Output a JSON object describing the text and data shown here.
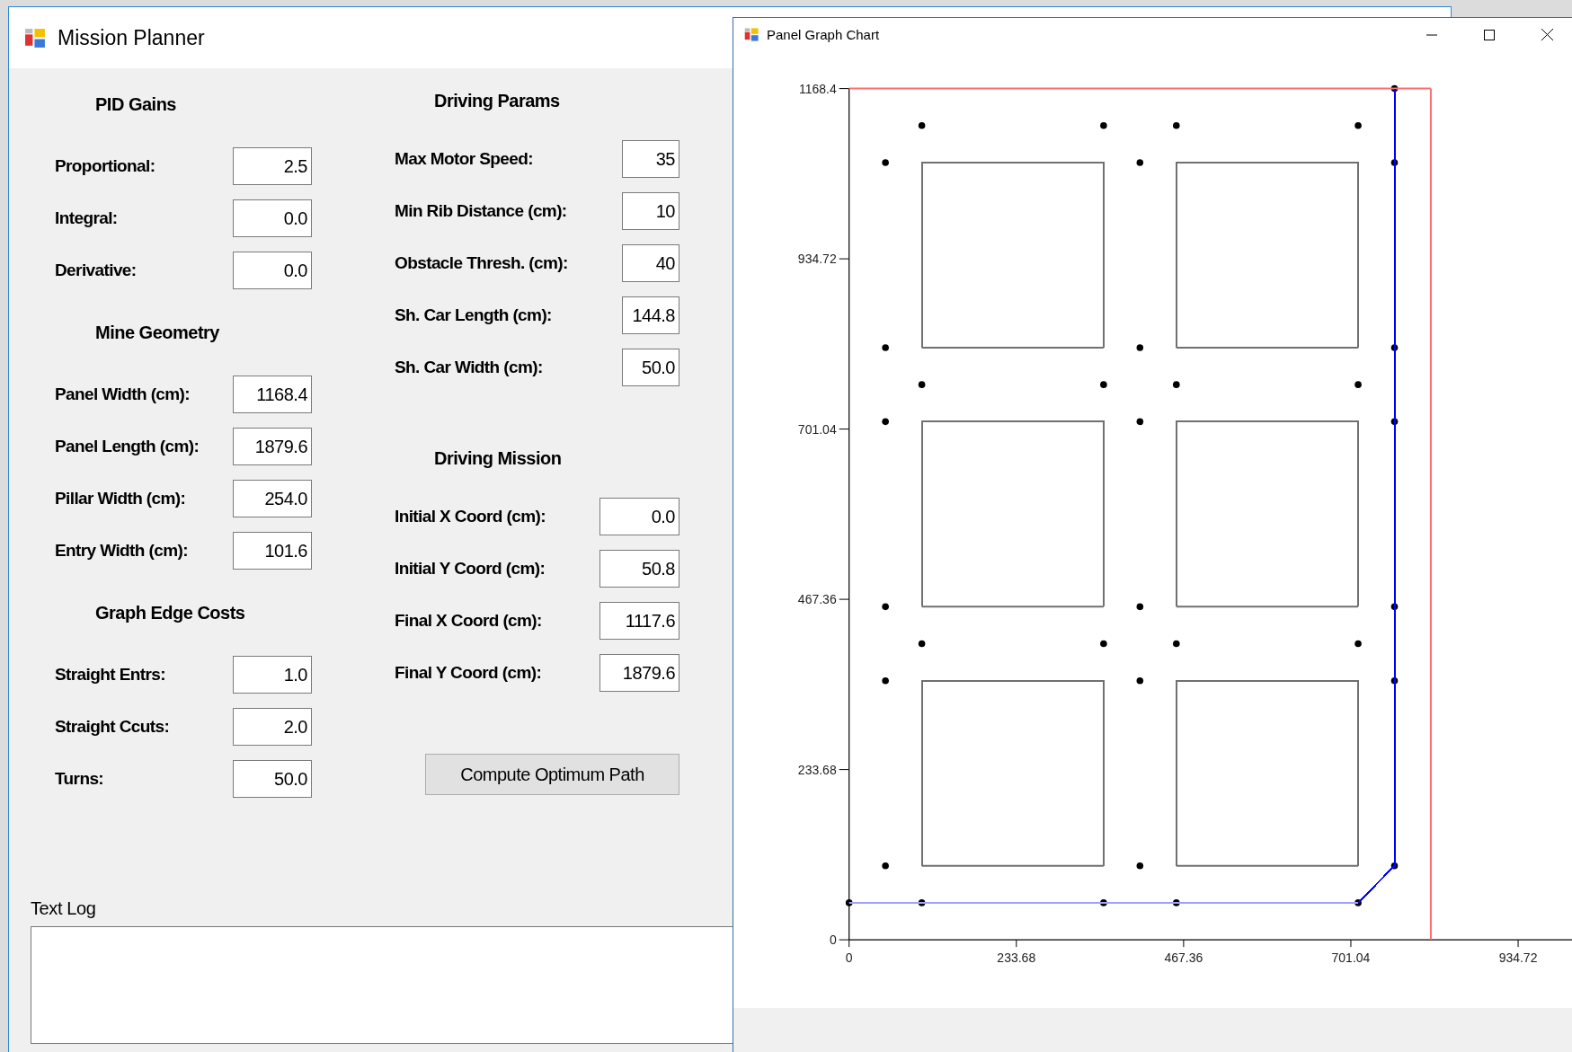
{
  "main_window": {
    "title": "Mission Planner",
    "left_sections": [
      {
        "header": "PID Gains",
        "fields": [
          {
            "label": "Proportional:",
            "value": "2.5"
          },
          {
            "label": "Integral:",
            "value": "0.0"
          },
          {
            "label": "Derivative:",
            "value": "0.0"
          }
        ]
      },
      {
        "header": "Mine Geometry",
        "fields": [
          {
            "label": "Panel Width (cm):",
            "value": "1168.4"
          },
          {
            "label": "Panel Length (cm):",
            "value": "1879.6"
          },
          {
            "label": "Pillar Width (cm):",
            "value": "254.0"
          },
          {
            "label": "Entry Width (cm):",
            "value": "101.6"
          }
        ]
      },
      {
        "header": "Graph Edge Costs",
        "fields": [
          {
            "label": "Straight Entrs:",
            "value": "1.0"
          },
          {
            "label": "Straight Ccuts:",
            "value": "2.0"
          },
          {
            "label": "Turns:",
            "value": "50.0"
          }
        ]
      }
    ],
    "right_sections": [
      {
        "header": "Driving Params",
        "fields": [
          {
            "label": "Max Motor Speed:",
            "value": "35"
          },
          {
            "label": "Min Rib Distance (cm):",
            "value": "10"
          },
          {
            "label": "Obstacle Thresh. (cm):",
            "value": "40"
          },
          {
            "label": "Sh. Car Length (cm):",
            "value": "144.8"
          },
          {
            "label": "Sh. Car Width (cm):",
            "value": "50.0"
          }
        ]
      },
      {
        "header": "Driving Mission",
        "fields": [
          {
            "label": "Initial X Coord (cm):",
            "value": "0.0"
          },
          {
            "label": "Initial Y Coord (cm):",
            "value": "50.8"
          },
          {
            "label": "Final X Coord (cm):",
            "value": "1117.6"
          },
          {
            "label": "Final Y Coord (cm):",
            "value": "1879.6"
          }
        ]
      }
    ],
    "button": "Compute Optimum Path",
    "text_log": {
      "label": "Text Log"
    }
  },
  "chart_window": {
    "title": "Panel Graph Chart",
    "chart_data": {
      "type": "scatter",
      "xlim": [
        0,
        1010
      ],
      "ylim": [
        0,
        1168.4
      ],
      "xticks": [
        0,
        233.68,
        467.36,
        701.04,
        934.72
      ],
      "yticks": [
        0,
        233.68,
        467.36,
        701.04,
        934.72,
        1168.4
      ],
      "series": [
        {
          "type": "line",
          "color": "#ff7070",
          "x": [
            0,
            812.8
          ],
          "values": [
            1168.4,
            1168.4
          ]
        },
        {
          "type": "line",
          "color": "#ff7070",
          "x": [
            812.8,
            812.8
          ],
          "values": [
            0,
            1168.4
          ]
        },
        {
          "type": "line",
          "color": "#707070",
          "x": [
            101.6,
            101.6,
            355.6,
            355.6
          ],
          "values": [
            101.6,
            355.6,
            355.6,
            101.6
          ]
        },
        {
          "type": "line",
          "color": "#707070",
          "x": [
            101.6,
            355.6
          ],
          "values": [
            101.6,
            101.6
          ]
        },
        {
          "type": "line",
          "color": "#707070",
          "x": [
            457.2,
            457.2,
            711.2,
            711.2
          ],
          "values": [
            101.6,
            355.6,
            355.6,
            101.6
          ]
        },
        {
          "type": "line",
          "color": "#707070",
          "x": [
            457.2,
            711.2
          ],
          "values": [
            101.6,
            101.6
          ]
        },
        {
          "type": "line",
          "color": "#707070",
          "x": [
            101.6,
            101.6,
            355.6,
            355.6
          ],
          "values": [
            457.2,
            711.2,
            711.2,
            457.2
          ]
        },
        {
          "type": "line",
          "color": "#707070",
          "x": [
            101.6,
            355.6
          ],
          "values": [
            457.2,
            457.2
          ]
        },
        {
          "type": "line",
          "color": "#707070",
          "x": [
            457.2,
            457.2,
            711.2,
            711.2
          ],
          "values": [
            457.2,
            711.2,
            711.2,
            457.2
          ]
        },
        {
          "type": "line",
          "color": "#707070",
          "x": [
            457.2,
            711.2
          ],
          "values": [
            457.2,
            457.2
          ]
        },
        {
          "type": "line",
          "color": "#707070",
          "x": [
            101.6,
            101.6,
            355.6,
            355.6
          ],
          "values": [
            812.8,
            1066.8,
            1066.8,
            812.8
          ]
        },
        {
          "type": "line",
          "color": "#707070",
          "x": [
            101.6,
            355.6
          ],
          "values": [
            812.8,
            812.8
          ]
        },
        {
          "type": "line",
          "color": "#707070",
          "x": [
            457.2,
            457.2,
            711.2,
            711.2
          ],
          "values": [
            812.8,
            1066.8,
            1066.8,
            812.8
          ]
        },
        {
          "type": "line",
          "color": "#707070",
          "x": [
            457.2,
            711.2
          ],
          "values": [
            812.8,
            812.8
          ]
        },
        {
          "type": "line",
          "color": "#a0a0ff",
          "x": [
            0,
            711.2
          ],
          "values": [
            50.8,
            50.8
          ]
        },
        {
          "type": "line",
          "color": "#0000ff",
          "x": [
            711.2,
            762,
            762
          ],
          "values": [
            50.8,
            101.6,
            1168.4
          ]
        },
        {
          "type": "scatter",
          "color": "#000000",
          "x": [
            101.6,
            355.6,
            457.2,
            711.2,
            50.8,
            406.4,
            762,
            50.8,
            406.4,
            762,
            101.6,
            355.6,
            457.2,
            711.2,
            50.8,
            406.4,
            762,
            50.8,
            406.4,
            762,
            101.6,
            355.6,
            457.2,
            711.2,
            50.8,
            406.4,
            762,
            50.8,
            406.4,
            762,
            0,
            101.6,
            355.6,
            457.2,
            711.2,
            762
          ],
          "values": [
            1117.6,
            1117.6,
            1117.6,
            1117.6,
            1066.8,
            1066.8,
            1066.8,
            812.8,
            812.8,
            812.8,
            762,
            762,
            762,
            762,
            711.2,
            711.2,
            711.2,
            457.2,
            457.2,
            457.2,
            406.4,
            406.4,
            406.4,
            406.4,
            355.6,
            355.6,
            355.6,
            101.6,
            101.6,
            101.6,
            50.8,
            50.8,
            50.8,
            50.8,
            50.8,
            1168.4
          ]
        }
      ]
    }
  }
}
